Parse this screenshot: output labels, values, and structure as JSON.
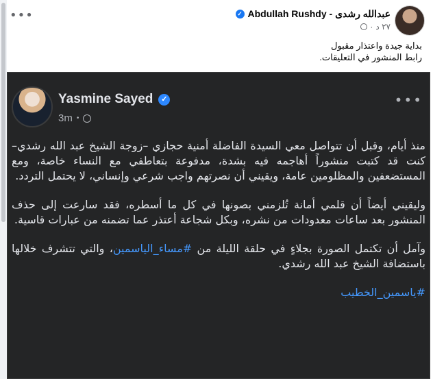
{
  "top_post": {
    "author": "عبدالله رشدى - Abdullah Rushdy",
    "time": "٢٧ د",
    "caption_line1": "بداية جيدة واعتذار مقبول",
    "caption_line2": "رابط المنشور في التعليقات."
  },
  "shared_post": {
    "name": "Yasmine Sayed",
    "time": "3m",
    "paragraph1": "منذ أيام، وقبل أن تتواصل معي السيدة الفاضلة أمنية حجازي –زوجة الشيخ عبد الله رشدي– كنت قد كتبت منشوراً أهاجمه فيه بشدة، مدفوعة بتعاطفي مع النساء خاصة، ومع المستضعفين والمظلومين عامة، ويقيني أن نصرتهم واجب شرعي وإنساني، لا يحتمل التردد.",
    "paragraph2": "وليقيني أيضاً أن قلمي أمانة تُلزمني بصونها في كل ما أسطره، فقد سارعت إلى حذف المنشور بعد ساعات معدودات من نشره، وبكل شجاعة أعتذر عما تضمنه من عبارات قاسية.",
    "paragraph3_start": "وآمل أن تكتمل الصورة بجلاءٍ في حلقة الليلة من ",
    "paragraph3_link": "#مساء_الياسمين",
    "paragraph3_end": "، والتي تتشرف خلالها باستضافة الشيخ عبد الله رشدي.",
    "hashtag": "#ياسمين_الخطيب"
  },
  "icons": {
    "verified": "verified-badge-icon",
    "globe": "globe-icon",
    "more": "more-options-icon"
  },
  "colors": {
    "dark_bg": "#242526",
    "text_dark": "#e4e6eb",
    "link": "#4599ff",
    "verified": "#2d88ff"
  }
}
